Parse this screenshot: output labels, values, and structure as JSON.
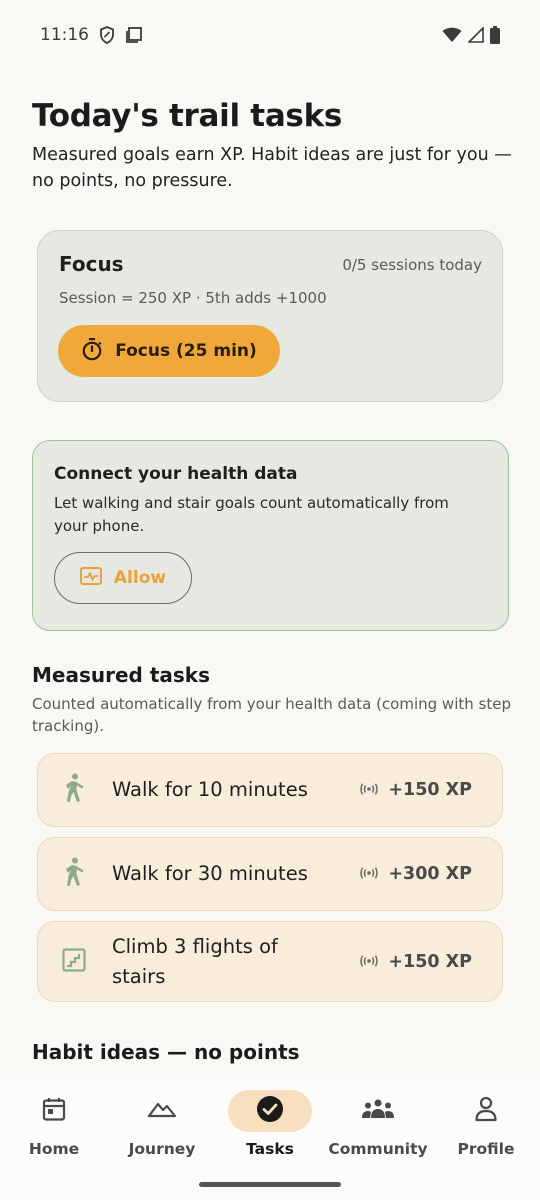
{
  "status_bar": {
    "time": "11:16"
  },
  "header": {
    "title": "Today's trail tasks",
    "subtitle": "Measured goals earn XP. Habit ideas are just for you — no points, no pressure."
  },
  "focus_card": {
    "title": "Focus",
    "sessions": "0/5 sessions today",
    "description": "Session = 250 XP · 5th adds +1000",
    "button_label": "Focus (25 min)"
  },
  "health_card": {
    "title": "Connect your health data",
    "description": "Let walking and stair goals count automatically from your phone.",
    "button_label": "Allow"
  },
  "measured": {
    "title": "Measured tasks",
    "subtitle": "Counted automatically from your health data (coming with step tracking).",
    "tasks": [
      {
        "label": "Walk for 10 minutes",
        "xp": "+150 XP",
        "icon": "walking-icon"
      },
      {
        "label": "Walk for 30 minutes",
        "xp": "+300 XP",
        "icon": "walking-icon"
      },
      {
        "label": "Climb 3 flights of stairs",
        "xp": "+150 XP",
        "icon": "stairs-icon"
      }
    ]
  },
  "habits": {
    "title": "Habit ideas — no points"
  },
  "nav": {
    "items": [
      {
        "label": "Home",
        "icon": "calendar-icon"
      },
      {
        "label": "Journey",
        "icon": "mountain-icon"
      },
      {
        "label": "Tasks",
        "icon": "check-circle-icon"
      },
      {
        "label": "Community",
        "icon": "people-icon"
      },
      {
        "label": "Profile",
        "icon": "person-icon"
      }
    ],
    "active": "Tasks"
  },
  "colors": {
    "accent": "#f0a83a",
    "card": "#e6e9e2",
    "task_card": "#f8ecdb",
    "icon_green": "#8faa8b"
  }
}
